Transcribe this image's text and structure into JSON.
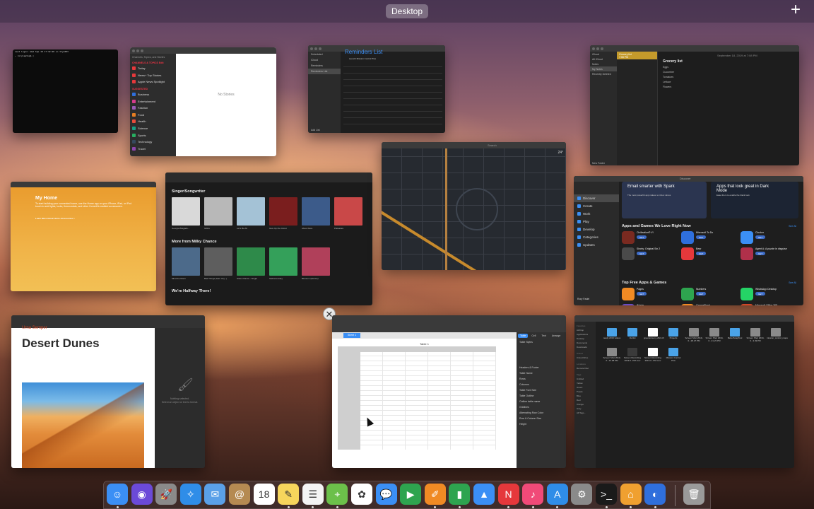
{
  "mission_control": {
    "space_label": "Desktop",
    "add_space_glyph": "+"
  },
  "terminal": {
    "lines": [
      "Last login: Wed Sep 18 17:32:40 on ttys003",
      "~ rorylaptop$ ▯"
    ]
  },
  "news": {
    "search_placeholder": "Channels, Topics, and Stories",
    "section_header": "CHANNELS & TOPICS",
    "edit_label": "Edit",
    "items": [
      {
        "label": "Today",
        "color": "#e5383b"
      },
      {
        "label": "News+ Top Stories",
        "color": "#e5383b"
      },
      {
        "label": "Apple News Spotlight",
        "color": "#e5383b"
      }
    ],
    "suggested_header": "SUGGESTED",
    "suggested": [
      {
        "label": "Business",
        "color": "#2f6fdc"
      },
      {
        "label": "Entertainment",
        "color": "#d63b8a"
      },
      {
        "label": "Fashion",
        "color": "#9b59b6"
      },
      {
        "label": "Food",
        "color": "#e67e22"
      },
      {
        "label": "Health",
        "color": "#e74c3c"
      },
      {
        "label": "Science",
        "color": "#16a085"
      },
      {
        "label": "Sports",
        "color": "#27ae60"
      },
      {
        "label": "Technology",
        "color": "#34495e"
      },
      {
        "label": "Travel",
        "color": "#8e44ad"
      }
    ],
    "empty_text": "No Stories"
  },
  "reminders": {
    "title": "Reminders List",
    "sidebar": [
      "Scheduled",
      "iCloud",
      "Reminders",
      "Reminders List"
    ],
    "item": "Launch Mission Control Plus",
    "add_list": "Add List"
  },
  "notes": {
    "folders": [
      "iCloud",
      "All iCloud",
      "Notes",
      "My Notes",
      "Recently Deleted"
    ],
    "note_title": "Grocery list",
    "note_time": "7:08 PM",
    "date_line": "September 18, 2019 at 7:08 PM",
    "body_title": "Grocery list",
    "body_items": [
      "Eggs",
      "Cucumber",
      "Tomatoes",
      "Lettuce",
      "Flowers"
    ],
    "new_folder": "New Folder"
  },
  "home": {
    "title": "My Home",
    "body": "To start building your connected home, use the Home app on your iPhone, iPad, or iPod touch to add lights, locks, thermostats, and other HomeKit-enabled accessories.",
    "link": "Learn More About Home Accessories >"
  },
  "music": {
    "section1": "Singer/Songwriter",
    "row1": [
      {
        "title": "Georgia Bragado...",
        "color": "#d9d9d9"
      },
      {
        "title": "Gibbs",
        "color": "#b8b8b8"
      },
      {
        "title": "Let's Be All",
        "color": "#a4c2d6"
      },
      {
        "title": "Give Up the Ghost",
        "color": "#7a1e1e"
      },
      {
        "title": "About Face",
        "color": "#3c5b8a"
      },
      {
        "title": "Palisades",
        "color": "#c94848"
      }
    ],
    "section2": "More from Milky Chance",
    "row2": [
      {
        "title": "Mind the Moon",
        "color": "#4c6a8a"
      },
      {
        "title": "Bad Things (feat. Izzy...)",
        "color": "#5e5e5e"
      },
      {
        "title": "Stolen Dance - Single",
        "color": "#2e8a4a"
      },
      {
        "title": "Sadnecessary",
        "color": "#34a05a"
      },
      {
        "title": "Blossom (Deluxe)",
        "color": "#b0405a"
      }
    ],
    "section3": "We're Halfway There!"
  },
  "maps": {
    "search_placeholder": "Search",
    "temp": "24°"
  },
  "app_store": {
    "window_title": "Discover",
    "sidebar": [
      "Discover",
      "Create",
      "Work",
      "Play",
      "Develop",
      "Categories",
      "Updates"
    ],
    "user": "Rory Fadel",
    "banner1": {
      "title": "Email smarter with Spark",
      "subtitle": "The most powerful app makes no inbox stress"
    },
    "banner2": {
      "title": "Apps that look great in Dark Mode",
      "subtitle": "Ease them to enable the black look"
    },
    "section1": "Apps and Games We Love Right Now",
    "section2": "Top Free Apps & Games",
    "see_all": "See All",
    "get": "GET",
    "apps1": [
      {
        "name": "Civilization® VI",
        "color": "#7a2a20"
      },
      {
        "name": "Microsoft To Do",
        "color": "#2f6fdc"
      },
      {
        "name": "Clocker",
        "color": "#3b8ff5"
      },
      {
        "name": "Shorty: Original Sin 2",
        "color": "#4a4a4a"
      },
      {
        "name": "Bear",
        "color": "#e5383b"
      },
      {
        "name": "Agent A: A puzzle in disguise",
        "color": "#b0304a"
      }
    ],
    "apps2": [
      {
        "name": "Pages",
        "rank": "1",
        "color": "#f08a24"
      },
      {
        "name": "Numbers",
        "rank": "2",
        "color": "#2ea44f"
      },
      {
        "name": "WhatsApp Desktop",
        "rank": "3",
        "color": "#25d366"
      },
      {
        "name": "iMovie",
        "rank": "4",
        "color": "#6a4bc4"
      },
      {
        "name": "GarageBand",
        "rank": "5",
        "color": "#f08a24"
      },
      {
        "name": "Microsoft Office 365",
        "rank": "6",
        "color": "#d24726"
      }
    ]
  },
  "pages": {
    "author": "Urna Semper",
    "title": "Desert Dunes",
    "format_hint_1": "Nothing selected.",
    "format_hint_2": "Select an object or text to format."
  },
  "numbers": {
    "sheet_tab": "Sheet 1",
    "table_title": "Table 1",
    "inspector_tabs": [
      "Table",
      "Cell",
      "Text",
      "Arrange"
    ],
    "labels": [
      "Table Styles",
      "Headers & Footer",
      "Table Name",
      "Rows",
      "Columns",
      "Table Font Size",
      "Table Outline",
      "Outline table name",
      "Gridlines",
      "Alternating Row Color",
      "Row & Column Size",
      "Height"
    ]
  },
  "finder": {
    "sidebar": [
      "Favorites",
      "AirDrop",
      "Applications",
      "Desktop",
      "Documents",
      "Downloads",
      "iCloud",
      "iCloud Drive",
      "Locations",
      "Remote Disc",
      "Tags",
      "Untitled",
      "Yellow",
      "Green",
      "Purple",
      "Blue",
      "Red",
      "Orange",
      "Gray",
      "All Tags..."
    ],
    "files": [
      {
        "name": "ready 2019 videos",
        "color": "#4aa3e8"
      },
      {
        "name": "Vectist",
        "color": "#4aa3e8"
      },
      {
        "name": "greenscreen_efficit.tif",
        "color": "#ffffff"
      },
      {
        "name": "Projects",
        "color": "#4aa3e8"
      },
      {
        "name": "Screen Shot 2019-0...28.27 PM",
        "color": "#8a8a8a"
      },
      {
        "name": "Screen Shot 2019-0...21.23 PM",
        "color": "#8a8a8a"
      },
      {
        "name": "BetterSnapTool",
        "color": "#4aa3e8"
      },
      {
        "name": "Screen Shot 2019-0...3.49 PM",
        "color": "#8a8a8a"
      },
      {
        "name": "mission_control_maps",
        "color": "#8a8a8a"
      },
      {
        "name": "Screen Shot 2019-0...13.08 PM",
        "color": "#8a8a8a"
      },
      {
        "name": "Screen Recording 2019-0...PM.mov",
        "color": "#3a3a3a"
      },
      {
        "name": "Screen Recording 2019-0...PM.mov",
        "color": "#ffffff"
      },
      {
        "name": "Mission Control Plus",
        "color": "#4aa3e8"
      }
    ]
  },
  "dock": {
    "icons": [
      {
        "name": "finder-icon",
        "glyph": "☺",
        "color": "#3b8ff5",
        "running": true
      },
      {
        "name": "siri-icon",
        "glyph": "◉",
        "color": "#6b4ad8",
        "running": false
      },
      {
        "name": "launchpad-icon",
        "glyph": "🚀",
        "color": "#8a8a8a",
        "running": false
      },
      {
        "name": "safari-icon",
        "glyph": "✧",
        "color": "#2f8de8",
        "running": false
      },
      {
        "name": "mail-icon",
        "glyph": "✉",
        "color": "#5aa0e8",
        "running": false
      },
      {
        "name": "contacts-icon",
        "glyph": "@",
        "color": "#b58a52",
        "running": false
      },
      {
        "name": "calendar-icon",
        "glyph": "18",
        "color": "#ffffff",
        "running": false
      },
      {
        "name": "notes-icon",
        "glyph": "✎",
        "color": "#f6d65c",
        "running": true
      },
      {
        "name": "reminders-icon",
        "glyph": "☰",
        "color": "#f4f4f4",
        "running": true
      },
      {
        "name": "maps-icon",
        "glyph": "⌖",
        "color": "#6cc04a",
        "running": true
      },
      {
        "name": "photos-icon",
        "glyph": "✿",
        "color": "#ffffff",
        "running": false
      },
      {
        "name": "messages-icon",
        "glyph": "💬",
        "color": "#3b8ff5",
        "running": false
      },
      {
        "name": "facetime-icon",
        "glyph": "▶",
        "color": "#2ea44f",
        "running": false
      },
      {
        "name": "pages-icon",
        "glyph": "✐",
        "color": "#f08a24",
        "running": true
      },
      {
        "name": "numbers-icon",
        "glyph": "▮",
        "color": "#2ea44f",
        "running": true
      },
      {
        "name": "keynote-icon",
        "glyph": "▲",
        "color": "#3b8ff5",
        "running": false
      },
      {
        "name": "news-icon",
        "glyph": "N",
        "color": "#e5383b",
        "running": true
      },
      {
        "name": "music-icon",
        "glyph": "♪",
        "color": "#f04a78",
        "running": true
      },
      {
        "name": "app-store-icon",
        "glyph": "A",
        "color": "#2f8de8",
        "running": true
      },
      {
        "name": "system-preferences-icon",
        "glyph": "⚙",
        "color": "#8a8a8a",
        "running": false
      },
      {
        "name": "terminal-icon",
        "glyph": ">_",
        "color": "#1a1a1a",
        "running": true
      },
      {
        "name": "home-icon",
        "glyph": "⌂",
        "color": "#f0a030",
        "running": true
      },
      {
        "name": "mission-control-plus-icon",
        "glyph": "◐",
        "color": "#2f6fdc",
        "running": true
      },
      {
        "name": "trash-icon",
        "glyph": "🗑",
        "color": "#9a9a9a",
        "running": false
      }
    ]
  }
}
